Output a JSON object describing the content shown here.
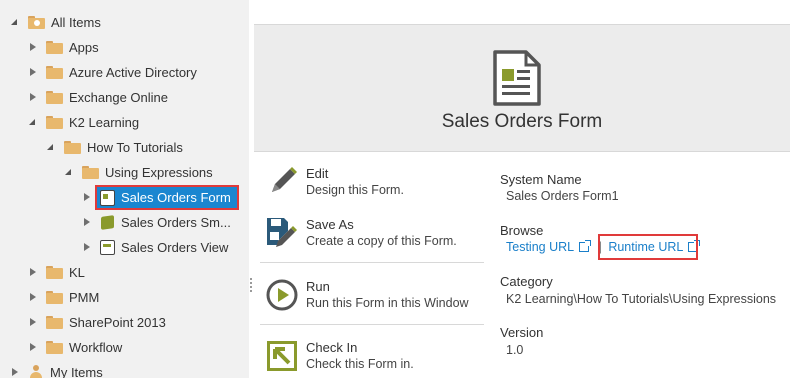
{
  "tree": {
    "items": [
      {
        "label": "All Items"
      },
      {
        "label": "Apps"
      },
      {
        "label": "Azure Active Directory"
      },
      {
        "label": "Exchange Online"
      },
      {
        "label": "K2 Learning"
      },
      {
        "label": "How To Tutorials"
      },
      {
        "label": "Using Expressions"
      },
      {
        "label": "Sales Orders Form"
      },
      {
        "label": "Sales Orders Sm..."
      },
      {
        "label": "Sales Orders View"
      },
      {
        "label": "KL"
      },
      {
        "label": "PMM"
      },
      {
        "label": "SharePoint 2013"
      },
      {
        "label": "Workflow"
      },
      {
        "label": "My Items"
      }
    ]
  },
  "header": {
    "title": "Sales Orders Form"
  },
  "actions": [
    {
      "title": "Edit",
      "desc": "Design this Form."
    },
    {
      "title": "Save As",
      "desc": "Create a copy of this Form."
    },
    {
      "title": "Run",
      "desc": "Run this Form in this Window"
    },
    {
      "title": "Check In",
      "desc": "Check this Form in."
    }
  ],
  "info": {
    "system_name_label": "System Name",
    "system_name_value": "Sales Orders Form1",
    "browse_label": "Browse",
    "testing_url": "Testing URL",
    "separator": "|",
    "runtime_url": "Runtime URL",
    "category_label": "Category",
    "category_value": "K2 Learning\\How To Tutorials\\Using Expressions",
    "version_label": "Version",
    "version_value": "1.0"
  },
  "colors": {
    "selected_bg": "#1a86d0",
    "highlight_border": "#e03a3a",
    "link": "#1a7fc9",
    "accent_green": "#8a9a2c",
    "folder": "#e8b86d"
  }
}
